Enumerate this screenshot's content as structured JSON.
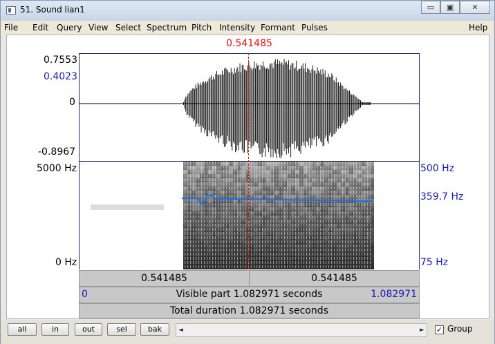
{
  "window": {
    "title": "51. Sound lian1"
  },
  "caption": {
    "minimize": "▭",
    "maximize": "▣",
    "close": "✕"
  },
  "menu": [
    "File",
    "Edit",
    "Query",
    "View",
    "Select",
    "Spectrum",
    "Pitch",
    "Intensity",
    "Formant",
    "Pulses",
    "Help"
  ],
  "cursor": {
    "time": "0.541485"
  },
  "waveform": {
    "max": "0.7553",
    "blue_upper": "0.4023",
    "zero": "0",
    "min": "-0.8967"
  },
  "spectrogram": {
    "freq_top": "5000 Hz",
    "freq_bottom": "0 Hz",
    "pitch_top": "500 Hz",
    "pitch_value": "359.7 Hz",
    "pitch_bottom": "75 Hz"
  },
  "selection_bar": {
    "left": "0.541485",
    "right": "0.541485"
  },
  "visible_bar": {
    "start": "0",
    "text": "Visible part 1.082971 seconds",
    "end": "1.082971"
  },
  "total_bar": {
    "text": "Total duration 1.082971 seconds"
  },
  "buttons": {
    "all": "all",
    "in": "in",
    "out": "out",
    "sel": "sel",
    "bak": "bak"
  },
  "scrollbar": {
    "left_arrow": "◄",
    "right_arrow": "►"
  },
  "group": {
    "label": "Group",
    "checked": "✓"
  }
}
